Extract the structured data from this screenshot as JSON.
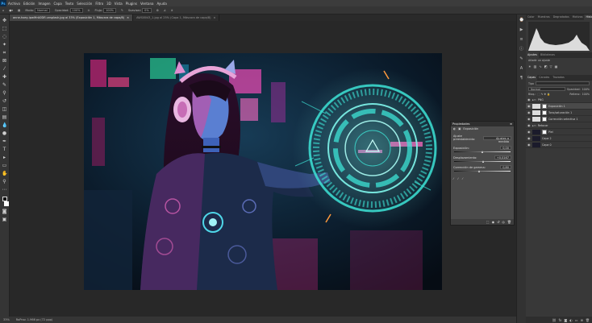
{
  "menubar": {
    "items": [
      "Archivo",
      "Edición",
      "Imagen",
      "Capa",
      "Texto",
      "Selección",
      "Filtro",
      "3D",
      "Vista",
      "Plugins",
      "Ventana",
      "Ayuda"
    ]
  },
  "options": {
    "mode_label": "Modo:",
    "mode_value": "Normal",
    "opacity_label": "Opacidad:",
    "opacity_value": "100%",
    "flow_label": "Flujo:",
    "flow_value": "100%",
    "smoothing_label": "Suavizar:",
    "smoothing_value": "0%"
  },
  "tabs": [
    {
      "label": "anne-hoey-ipwlHrA0Dfl-unsplash.jpg al 33% (Exposición 1, Máscara de capa/8)",
      "active": true
    },
    {
      "label": "AWG8043_1.jpg al 25% (Capa 1, Máscara de capa/8)",
      "active": false
    }
  ],
  "status": {
    "zoom": "33%",
    "doc": "RoProv. 1.966 px (72 ppp)"
  },
  "panels": {
    "top_tabs": [
      "Color",
      "Muestras",
      "Degradados",
      "Motivos",
      "Histograma"
    ],
    "active_top_tab": "Histograma",
    "adj_tabs": [
      "Ajustes",
      "Bibliotecas"
    ],
    "adj_hint": "Añadir un ajuste",
    "layer_tabs": [
      "Capas",
      "Canales",
      "Trazados"
    ],
    "kind_label": "Tipo",
    "blend_mode": "Normal",
    "opacity_label": "Opacidad:",
    "opacity_value": "100%",
    "lock_label": "Bloq.:",
    "fill_label": "Relleno:",
    "fill_value": "100%",
    "layers": [
      {
        "name": "PNG",
        "type": "group",
        "selected": false
      },
      {
        "name": "Exposición 1",
        "type": "adj",
        "selected": true
      },
      {
        "name": "Tono/saturación 1",
        "type": "adj",
        "selected": false
      },
      {
        "name": "Corrección selectiva 1",
        "type": "adj",
        "selected": false
      },
      {
        "name": "Retocar",
        "type": "group",
        "selected": false
      },
      {
        "name": "Piel",
        "type": "mask",
        "selected": false
      },
      {
        "name": "Capa 2",
        "type": "pixel",
        "selected": false
      },
      {
        "name": "Capa 0",
        "type": "pixel",
        "selected": false
      }
    ]
  },
  "properties": {
    "title": "Propiedades",
    "subtitle": "Exposición",
    "preset_label": "Ajuste preestablecido:",
    "preset_value": "Ajustes a medida",
    "exposure_label": "Exposición:",
    "exposure_value": "0,00",
    "exposure_level": 0.5,
    "offset_label": "Desplazamiento:",
    "offset_value": "+0,0167",
    "offset_level": 0.52,
    "gamma_label": "Corrección de gamma:",
    "gamma_value": "0,80",
    "gamma_level": 0.45
  },
  "colors": {
    "accent": "#31a8ff",
    "cyan_hud": "#3de3d6",
    "magenta": "#ff3fa6",
    "panel_bg": "#383838"
  }
}
